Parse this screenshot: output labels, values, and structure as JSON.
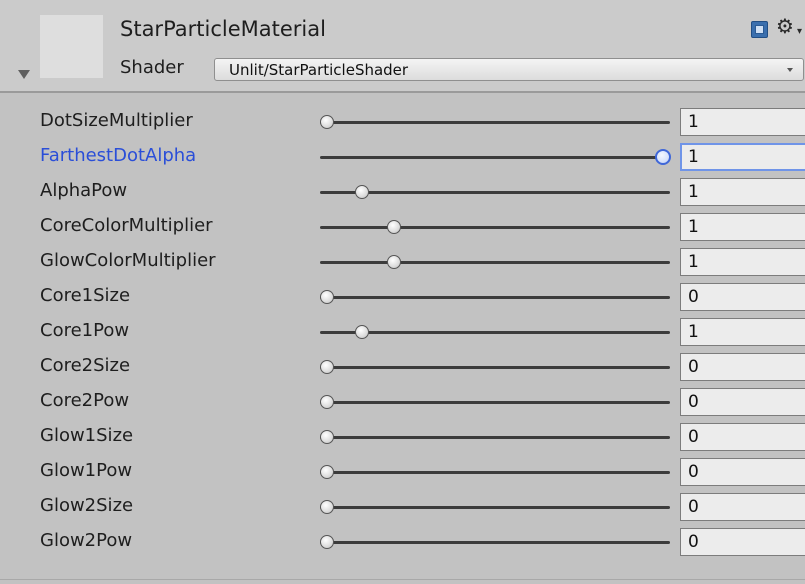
{
  "header": {
    "material_name": "StarParticleMaterial",
    "shader_label": "Shader",
    "shader_value": "Unlit/StarParticleShader",
    "icons": {
      "help": "help-book-icon",
      "settings": "gear-icon"
    }
  },
  "properties": [
    {
      "label": "DotSizeMultiplier",
      "value": "1",
      "slider_fraction": 0.02,
      "active": false
    },
    {
      "label": "FarthestDotAlpha",
      "value": "1",
      "slider_fraction": 0.98,
      "active": true
    },
    {
      "label": "AlphaPow",
      "value": "1",
      "slider_fraction": 0.12,
      "active": false
    },
    {
      "label": "CoreColorMultiplier",
      "value": "1",
      "slider_fraction": 0.21,
      "active": false
    },
    {
      "label": "GlowColorMultiplier",
      "value": "1",
      "slider_fraction": 0.21,
      "active": false
    },
    {
      "label": "Core1Size",
      "value": "0",
      "slider_fraction": 0.02,
      "active": false
    },
    {
      "label": "Core1Pow",
      "value": "1",
      "slider_fraction": 0.12,
      "active": false
    },
    {
      "label": "Core2Size",
      "value": "0",
      "slider_fraction": 0.02,
      "active": false
    },
    {
      "label": "Core2Pow",
      "value": "0",
      "slider_fraction": 0.02,
      "active": false
    },
    {
      "label": "Glow1Size",
      "value": "0",
      "slider_fraction": 0.02,
      "active": false
    },
    {
      "label": "Glow1Pow",
      "value": "0",
      "slider_fraction": 0.02,
      "active": false
    },
    {
      "label": "Glow2Size",
      "value": "0",
      "slider_fraction": 0.02,
      "active": false
    },
    {
      "label": "Glow2Pow",
      "value": "0",
      "slider_fraction": 0.02,
      "active": false
    }
  ],
  "colors": {
    "background": "#c2c2c2",
    "active_label": "#2a4ed8",
    "active_field_border": "#6f94e8"
  }
}
